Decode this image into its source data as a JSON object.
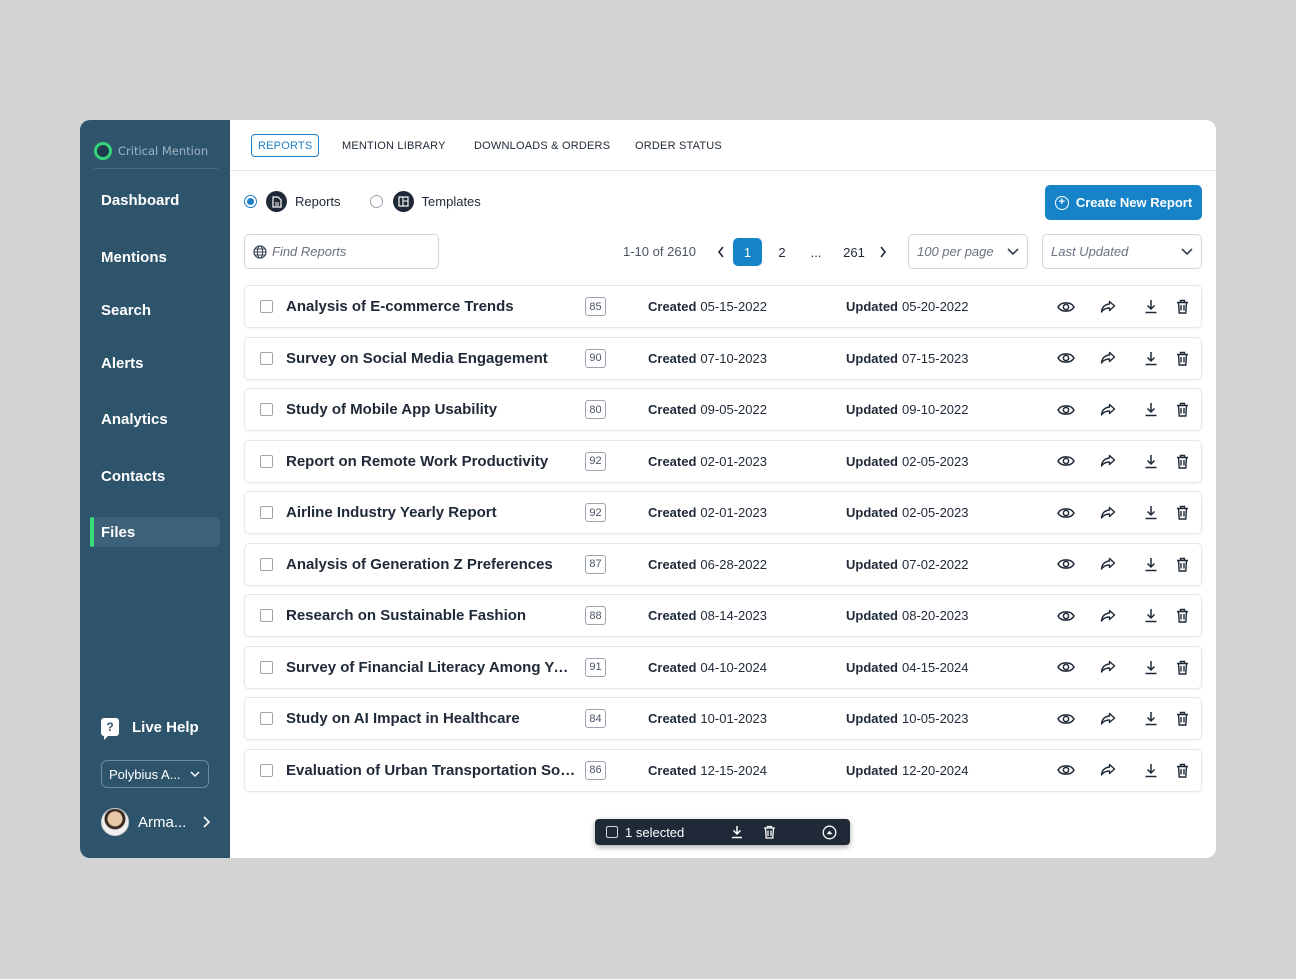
{
  "brand": {
    "name": "Critical Mention"
  },
  "sidebar": {
    "nav": [
      {
        "label": "Dashboard",
        "active": false
      },
      {
        "label": "Mentions",
        "active": false
      },
      {
        "label": "Search",
        "active": false
      },
      {
        "label": "Alerts",
        "active": false
      },
      {
        "label": "Analytics",
        "active": false
      },
      {
        "label": "Contacts",
        "active": false
      },
      {
        "label": "Files",
        "active": true
      }
    ],
    "live_help": "Live Help",
    "workspace": "Polybius A...",
    "user_name": "Arma..."
  },
  "tabs": [
    {
      "label": "REPORTS",
      "active": true
    },
    {
      "label": "MENTION LIBRARY",
      "active": false
    },
    {
      "label": "DOWNLOADS & ORDERS",
      "active": false
    },
    {
      "label": "ORDER STATUS",
      "active": false
    }
  ],
  "type_filter": {
    "reports": "Reports",
    "templates": "Templates",
    "selected": "Reports"
  },
  "create_button": "Create New Report",
  "search": {
    "placeholder": "Find Reports",
    "value": ""
  },
  "pagination": {
    "range": "1-10 of 2610",
    "pages": [
      "1",
      "2",
      "...",
      "261"
    ],
    "current": "1"
  },
  "per_page": "100 per page",
  "sort": "Last Updated",
  "labels": {
    "created": "Created",
    "updated": "Updated"
  },
  "reports": [
    {
      "title": "Analysis of E-commerce Trends",
      "score": "85",
      "created": "05-15-2022",
      "updated": "05-20-2022",
      "checked": false
    },
    {
      "title": "Survey on Social Media Engagement",
      "score": "90",
      "created": "07-10-2023",
      "updated": "07-15-2023",
      "checked": false
    },
    {
      "title": "Study of Mobile App Usability",
      "score": "80",
      "created": "09-05-2022",
      "updated": "09-10-2022",
      "checked": false
    },
    {
      "title": "Report on Remote Work Productivity",
      "score": "92",
      "created": "02-01-2023",
      "updated": "02-05-2023",
      "checked": false
    },
    {
      "title": "Airline Industry Yearly Report",
      "score": "92",
      "created": "02-01-2023",
      "updated": "02-05-2023",
      "checked": false
    },
    {
      "title": "Analysis of Generation Z Preferences",
      "score": "87",
      "created": "06-28-2022",
      "updated": "07-02-2022",
      "checked": false
    },
    {
      "title": "Research on Sustainable Fashion",
      "score": "88",
      "created": "08-14-2023",
      "updated": "08-20-2023",
      "checked": false
    },
    {
      "title": "Survey of Financial Literacy Among You...",
      "score": "91",
      "created": "04-10-2024",
      "updated": "04-15-2024",
      "checked": false
    },
    {
      "title": "Study on AI Impact in Healthcare",
      "score": "84",
      "created": "10-01-2023",
      "updated": "10-05-2023",
      "checked": false
    },
    {
      "title": "Evaluation of Urban Transportation Sol...",
      "score": "86",
      "created": "12-15-2024",
      "updated": "12-20-2024",
      "checked": false
    }
  ],
  "bulk_bar": {
    "selected_text": "1 selected"
  },
  "colors": {
    "sidebar": "#2e546c",
    "accent": "#1682c7",
    "active_indicator": "#3bdc7a"
  }
}
